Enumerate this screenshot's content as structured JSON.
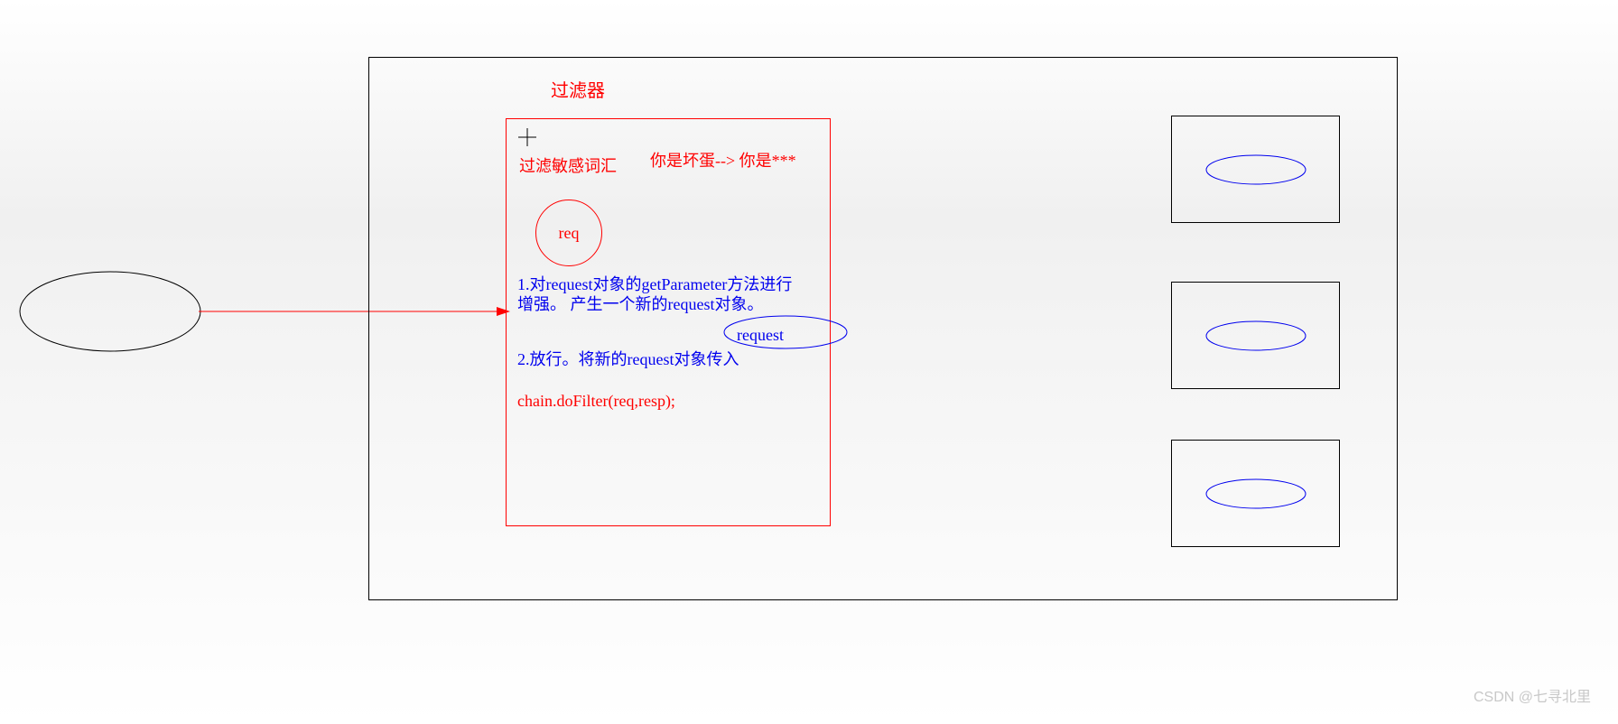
{
  "filter_title": "过滤器",
  "filter_sensitive": "过滤敏感词汇",
  "example": "你是坏蛋--> 你是***",
  "req_label": "req",
  "step1": "1.对request对象的getParameter方法进行增强。  产生一个新的request对象。",
  "step2": "2.放行。将新的request对象传入",
  "chain_code": "chain.doFilter(req,resp);",
  "request_label": "request",
  "watermark": "CSDN @七寻北里"
}
